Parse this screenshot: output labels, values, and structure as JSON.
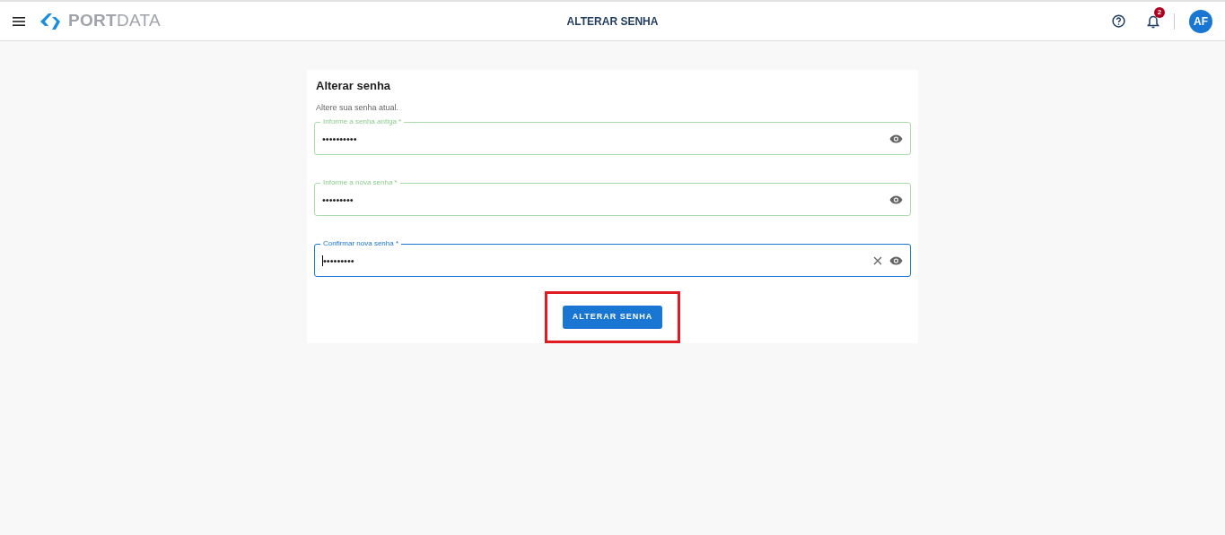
{
  "header": {
    "brand": "**PORT**DATA",
    "title": "ALTERAR SENHA",
    "notifications": {
      "count": "2"
    },
    "avatar": "AF"
  },
  "card": {
    "title": "Alterar senha",
    "subtitle": "Altere sua senha atual.",
    "fields": [
      {
        "label": "Informe a senha antiga *",
        "value": "••••••••••",
        "focused": false,
        "clearable": false
      },
      {
        "label": "Informe a nova senha *",
        "value": "•••••••••",
        "focused": false,
        "clearable": false
      },
      {
        "label": "Confirmar nova senha *",
        "value": "•••••••••",
        "focused": true,
        "clearable": true
      }
    ],
    "button": {
      "label": "ALTERAR SENHA",
      "highlighted": true
    }
  }
}
